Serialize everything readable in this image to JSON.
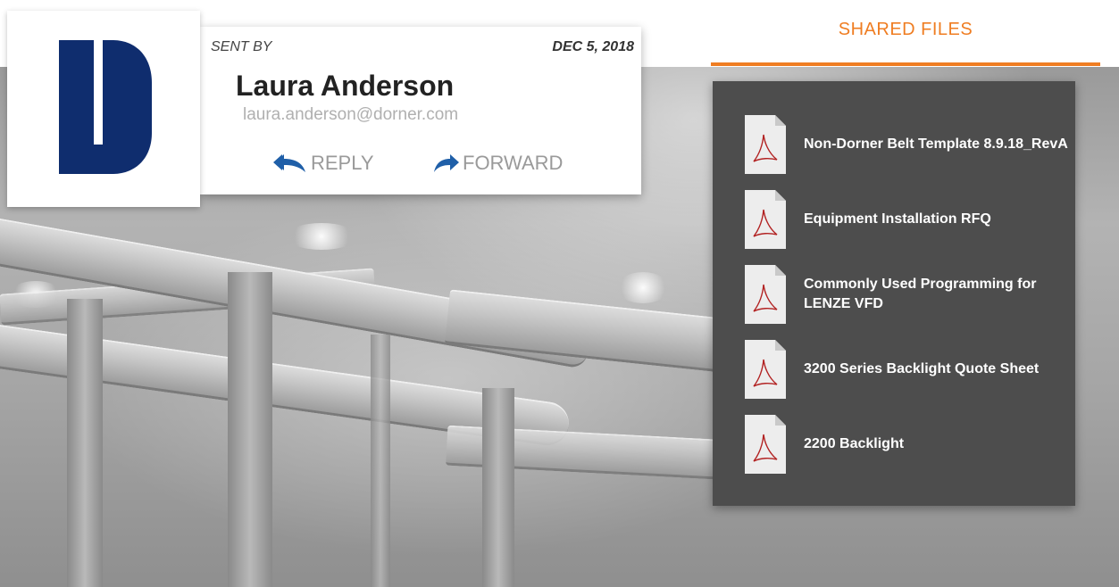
{
  "logo": {
    "icon": "dorner-d-logo-icon",
    "color": "#0f2d6e"
  },
  "sender": {
    "sent_by_label": "SENT BY",
    "date": "DEC 5, 2018",
    "name": "Laura Anderson",
    "email": "laura.anderson@dorner.com",
    "actions": {
      "reply_label": "REPLY",
      "reply_icon": "reply-all-arrow-icon",
      "forward_label": "FORWARD",
      "forward_icon": "forward-arrow-icon",
      "icon_color": "#1f5fa8"
    }
  },
  "shared_files": {
    "title": "SHARED FILES",
    "accent_color": "#ef7d22",
    "files": [
      {
        "name": "Non-Dorner Belt Template 8.9.18_RevA",
        "icon": "pdf-file-icon"
      },
      {
        "name": "Equipment Installation RFQ",
        "icon": "pdf-file-icon"
      },
      {
        "name": "Commonly Used Programming for LENZE VFD",
        "icon": "pdf-file-icon"
      },
      {
        "name": "3200 Series Backlight Quote Sheet",
        "icon": "pdf-file-icon"
      },
      {
        "name": "2200 Backlight",
        "icon": "pdf-file-icon"
      }
    ]
  }
}
